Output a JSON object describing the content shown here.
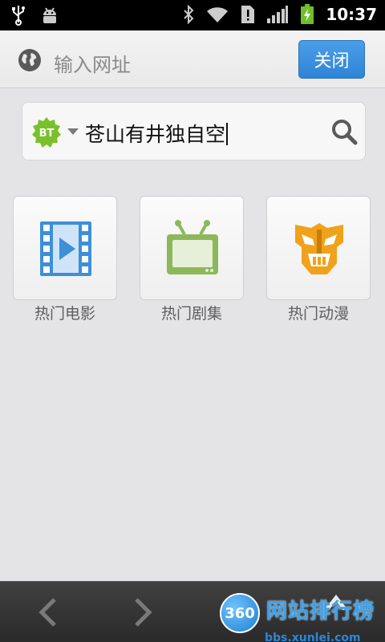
{
  "status_bar": {
    "time": "10:37",
    "icons": [
      "usb-icon",
      "android-debug-icon",
      "bluetooth-icon",
      "wifi-icon",
      "sim-alert-icon",
      "signal-icon",
      "battery-charging-icon"
    ]
  },
  "address_bar": {
    "placeholder": "输入网址",
    "close_label": "关闭",
    "icon": "globe-icon"
  },
  "search": {
    "engine_badge": "BT",
    "query": "苍山有井独自空",
    "icon": "search-icon"
  },
  "categories": [
    {
      "label": "热门电影",
      "icon": "film-icon"
    },
    {
      "label": "热门剧集",
      "icon": "tv-icon"
    },
    {
      "label": "热门动漫",
      "icon": "transformer-icon"
    }
  ],
  "bottom_bar": {
    "back_icon": "chevron-left-icon",
    "forward_icon": "chevron-right-icon",
    "watermark_logo": "360",
    "watermark_title": "网站排行榜",
    "watermark_url": "bbs.xunlei.com"
  },
  "colors": {
    "accent_blue": "#2f84d6",
    "badge_green": "#7ac02a",
    "film_blue": "#3d8fd8",
    "tv_green": "#8cb85a",
    "transformer_orange": "#f0a21a"
  }
}
